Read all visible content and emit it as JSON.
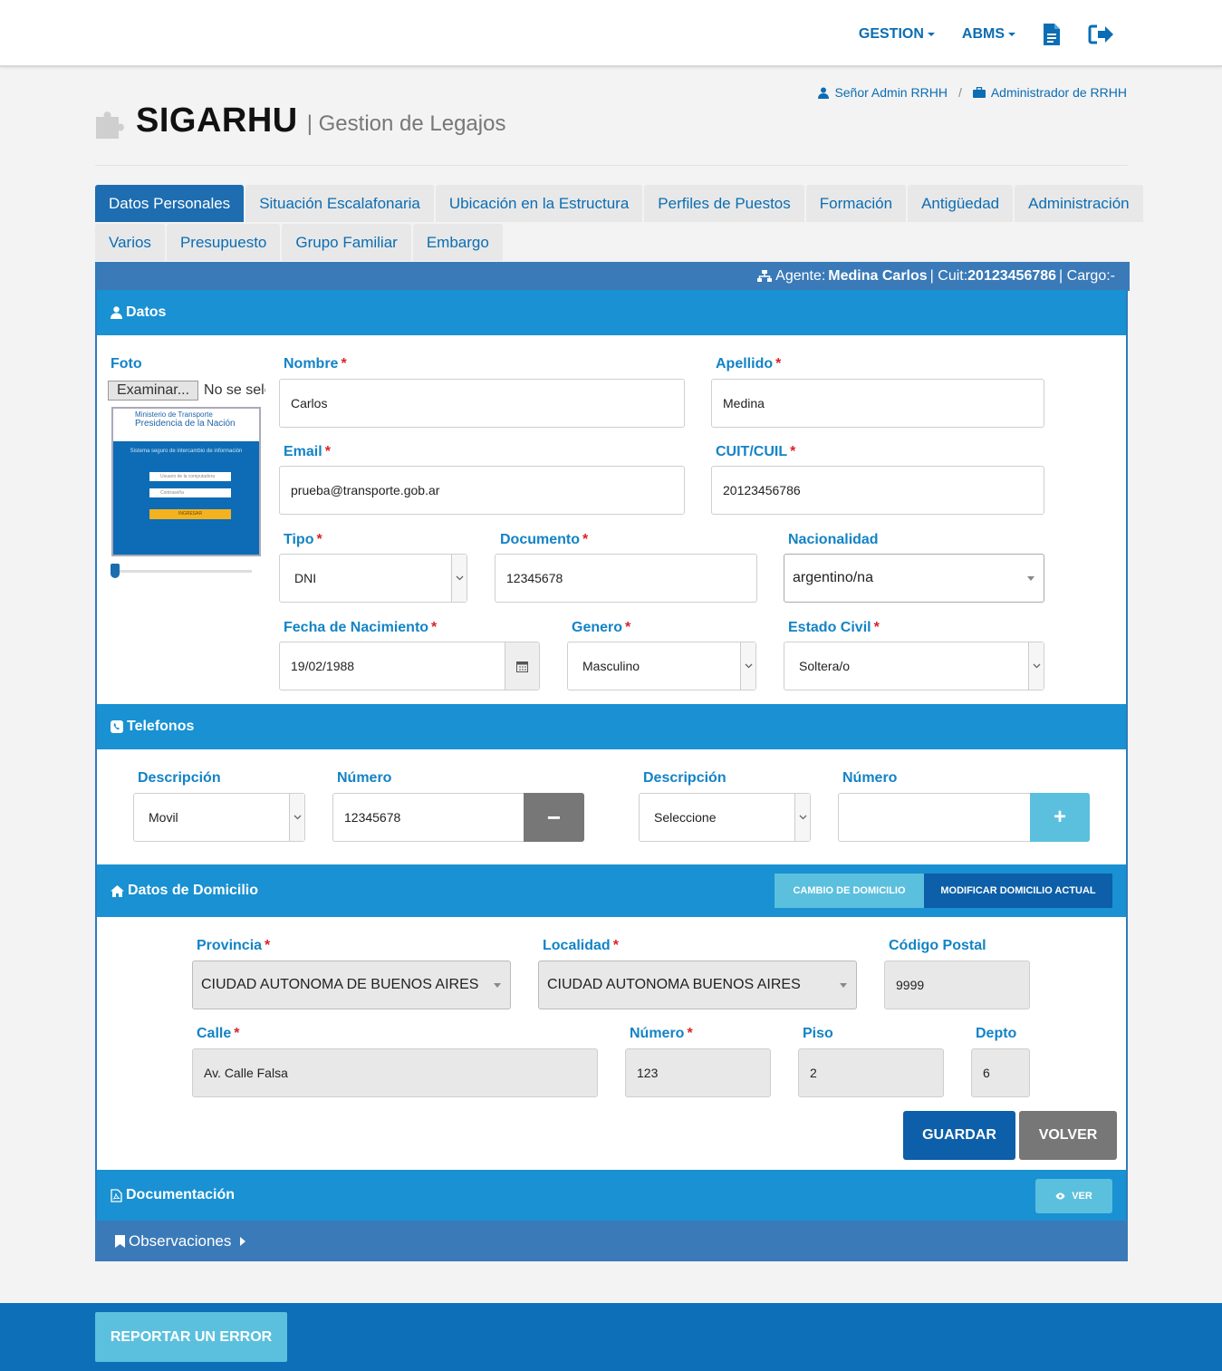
{
  "nav": {
    "gestion": "GESTION",
    "abms": "ABMS",
    "doc_icon": "document-icon",
    "exit_icon": "sign-out-icon"
  },
  "user": {
    "name": "Señor Admin RRHH",
    "separator": "/",
    "role": "Administrador de RRHH"
  },
  "brand": {
    "title": "SIGARHU",
    "subtitle": "| Gestion de Legajos"
  },
  "tabs_row1": [
    "Datos Personales",
    "Situación Escalafonaria",
    "Ubicación en la Estructura",
    "Perfiles de Puestos",
    "Formación",
    "Antigüedad",
    "Administración"
  ],
  "tabs_row2": [
    "Varios",
    "Presupuesto",
    "Grupo Familiar",
    "Embargo"
  ],
  "agent": {
    "label": "Agente:",
    "name": "Medina Carlos",
    "cuit_label": "| Cuit:",
    "cuit": "20123456786",
    "cargo": "| Cargo:-"
  },
  "datos": {
    "header": "Datos",
    "foto_label": "Foto",
    "file_button": "Examinar...",
    "file_status": "No se sele",
    "thumb_line1": "Ministerio de Transporte",
    "thumb_line2": "Presidencia de la Nación",
    "thumb_line3": "Sistema seguro de intercambio de información",
    "thumb_field1": "Usuario de la computadora",
    "thumb_field2": "Contraseña",
    "thumb_button": "INGRESAR",
    "nombre_label": "Nombre",
    "nombre": "Carlos",
    "apellido_label": "Apellido",
    "apellido": "Medina",
    "email_label": "Email",
    "email": "prueba@transporte.gob.ar",
    "cuit_label": "CUIT/CUIL",
    "cuit": "20123456786",
    "tipo_label": "Tipo",
    "tipo": "DNI",
    "documento_label": "Documento",
    "documento": "12345678",
    "nacionalidad_label": "Nacionalidad",
    "nacionalidad": "argentino/na",
    "fecha_label": "Fecha de Nacimiento",
    "fecha": "19/02/1988",
    "genero_label": "Genero",
    "genero": "Masculino",
    "estado_label": "Estado Civil",
    "estado": "Soltera/o",
    "required": "*"
  },
  "telefonos": {
    "header": "Telefonos",
    "desc_label": "Descripción",
    "num_label": "Número",
    "row1_desc": "Movil",
    "row1_num": "12345678",
    "remove_btn": "−",
    "row2_desc": "Seleccione",
    "row2_num": "",
    "add_btn": "+"
  },
  "domicilio": {
    "header": "Datos de Domicilio",
    "cambio_btn": "CAMBIO DE DOMICILIO",
    "modificar_btn": "MODIFICAR DOMICILIO ACTUAL",
    "provincia_label": "Provincia",
    "provincia": "CIUDAD AUTONOMA DE BUENOS AIRES",
    "localidad_label": "Localidad",
    "localidad": "CIUDAD AUTONOMA BUENOS AIRES",
    "cp_label": "Código Postal",
    "cp": "9999",
    "calle_label": "Calle",
    "calle": "Av. Calle Falsa",
    "numero_label": "Número",
    "numero": "123",
    "piso_label": "Piso",
    "piso": "2",
    "depto_label": "Depto",
    "depto": "6"
  },
  "actions": {
    "guardar": "GUARDAR",
    "volver": "VOLVER"
  },
  "documentacion": {
    "header": "Documentación",
    "ver_btn": "VER"
  },
  "observaciones": {
    "header": "Observaciones"
  },
  "footer": {
    "report_btn": "REPORTAR UN ERROR"
  },
  "colors": {
    "primary": "#1991d2",
    "dark_blue": "#0b6db3",
    "light_blue": "#5bc0de",
    "label_blue": "#1383c6",
    "required_red": "#d9222a",
    "gray_button": "#777777"
  }
}
